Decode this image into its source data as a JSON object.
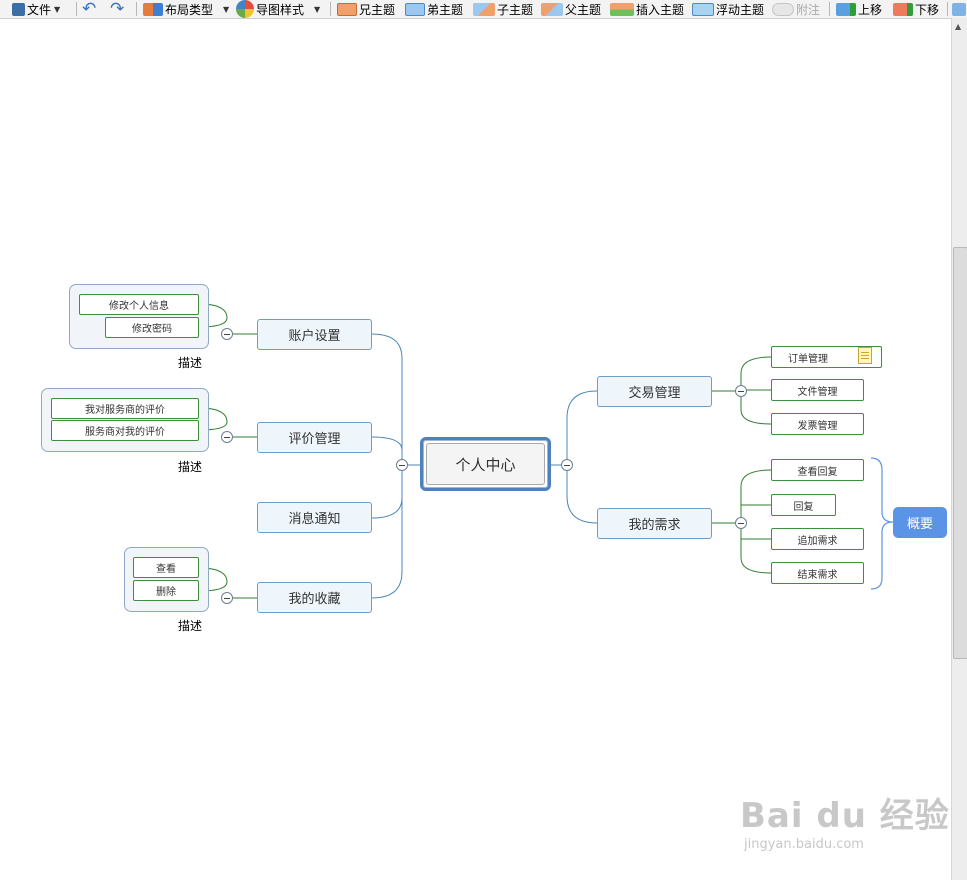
{
  "toolbar": {
    "file": "文件",
    "layout_type": "布局类型",
    "map_style": "导图样式",
    "sibling_before": "兄主题",
    "sibling_after": "弟主题",
    "child_topic": "子主题",
    "parent_topic": "父主题",
    "insert_topic": "插入主题",
    "floating_topic": "浮动主题",
    "note": "附注",
    "move_up": "上移",
    "move_down": "下移"
  },
  "mindmap": {
    "central": "个人中心",
    "left": {
      "account": {
        "label": "账户设置",
        "children": [
          "修改个人信息",
          "修改密码"
        ],
        "caption": "描述"
      },
      "review": {
        "label": "评价管理",
        "children": [
          "我对服务商的评价",
          "服务商对我的评价"
        ],
        "caption": "描述"
      },
      "messages": {
        "label": "消息通知"
      },
      "favorites": {
        "label": "我的收藏",
        "children": [
          "查看",
          "删除"
        ],
        "caption": "描述"
      }
    },
    "right": {
      "trade": {
        "label": "交易管理",
        "children": [
          "订单管理",
          "文件管理",
          "发票管理"
        ]
      },
      "needs": {
        "label": "我的需求",
        "children": [
          "查看回复",
          "回复",
          "追加需求",
          "结束需求"
        ]
      },
      "summary": "概要"
    }
  },
  "watermark": {
    "main": "Bai du 经验",
    "sub": "jingyan.baidu.com"
  },
  "colors": {
    "central_border": "#4f81bd",
    "main_topic_fill": "#eef5fb",
    "main_topic_border": "#6e9ec7",
    "leaf_border": "#3e8e3e",
    "summary_fill": "#5b94e6"
  }
}
